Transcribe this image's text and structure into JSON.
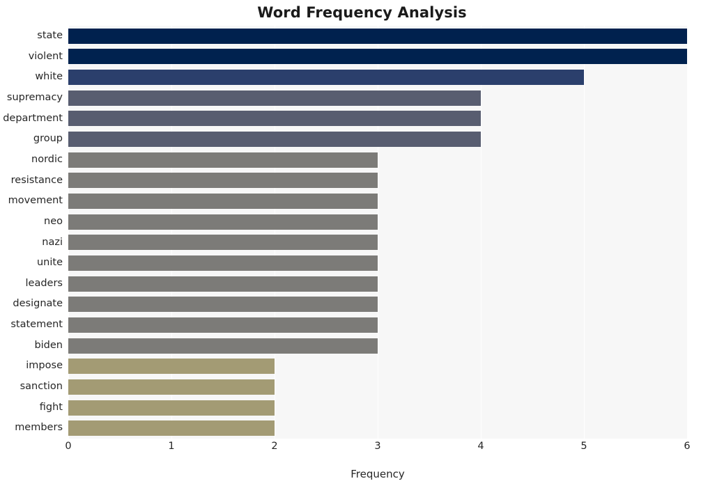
{
  "chart_data": {
    "type": "bar",
    "orientation": "horizontal",
    "title": "Word Frequency Analysis",
    "xlabel": "Frequency",
    "ylabel": "",
    "xlim": [
      0,
      6
    ],
    "xticks": [
      0,
      1,
      2,
      3,
      4,
      5,
      6
    ],
    "grid": true,
    "legend": null,
    "categories": [
      "state",
      "violent",
      "white",
      "supremacy",
      "department",
      "group",
      "nordic",
      "resistance",
      "movement",
      "neo",
      "nazi",
      "unite",
      "leaders",
      "designate",
      "statement",
      "biden",
      "impose",
      "sanction",
      "fight",
      "members"
    ],
    "values": [
      6,
      6,
      5,
      4,
      4,
      4,
      3,
      3,
      3,
      3,
      3,
      3,
      3,
      3,
      3,
      3,
      2,
      2,
      2,
      2
    ],
    "bar_colors": [
      "#00214e",
      "#00224f",
      "#2b3f6c",
      "#585d70",
      "#585d70",
      "#585d70",
      "#7c7b78",
      "#7c7b78",
      "#7c7b78",
      "#7c7b78",
      "#7c7b78",
      "#7c7b78",
      "#7c7b78",
      "#7c7b78",
      "#7c7b78",
      "#7c7b78",
      "#a39b74",
      "#a39b74",
      "#a39b74",
      "#a39b74"
    ],
    "plot_background": "#f7f7f7",
    "gridline_color": "#ffffff",
    "figure_background": "#ffffff",
    "text_color": "#262626"
  }
}
